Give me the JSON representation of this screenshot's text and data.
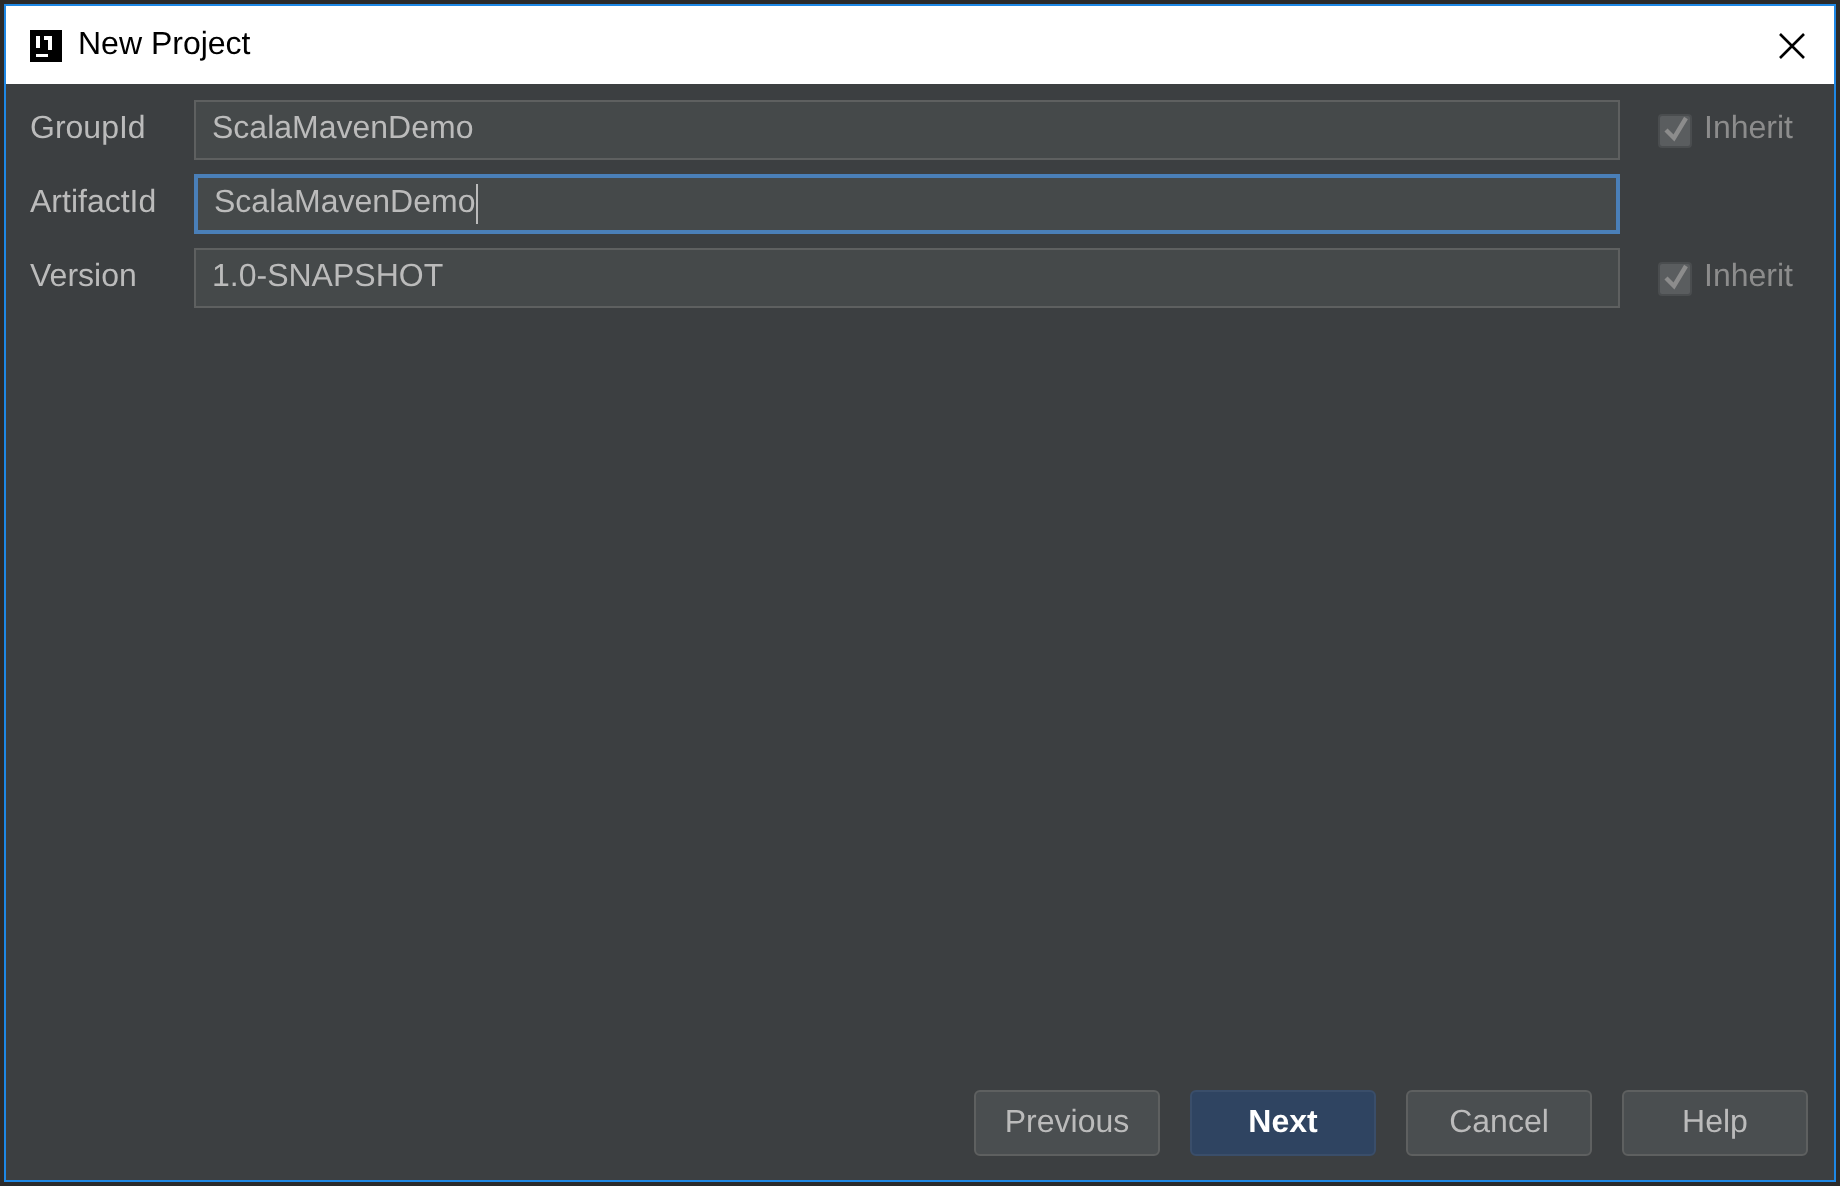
{
  "window": {
    "title": "New Project"
  },
  "fields": [
    {
      "label": "GroupId",
      "value": "ScalaMavenDemo",
      "focused": false,
      "inherit": {
        "label": "Inherit",
        "checked": true
      }
    },
    {
      "label": "ArtifactId",
      "value": "ScalaMavenDemo",
      "focused": true
    },
    {
      "label": "Version",
      "value": "1.0-SNAPSHOT",
      "focused": false,
      "inherit": {
        "label": "Inherit",
        "checked": true
      }
    }
  ],
  "buttons": [
    {
      "label": "Previous",
      "kind": "normal"
    },
    {
      "label": "Next",
      "kind": "default"
    },
    {
      "label": "Cancel",
      "kind": "normal"
    },
    {
      "label": "Help",
      "kind": "normal"
    }
  ]
}
